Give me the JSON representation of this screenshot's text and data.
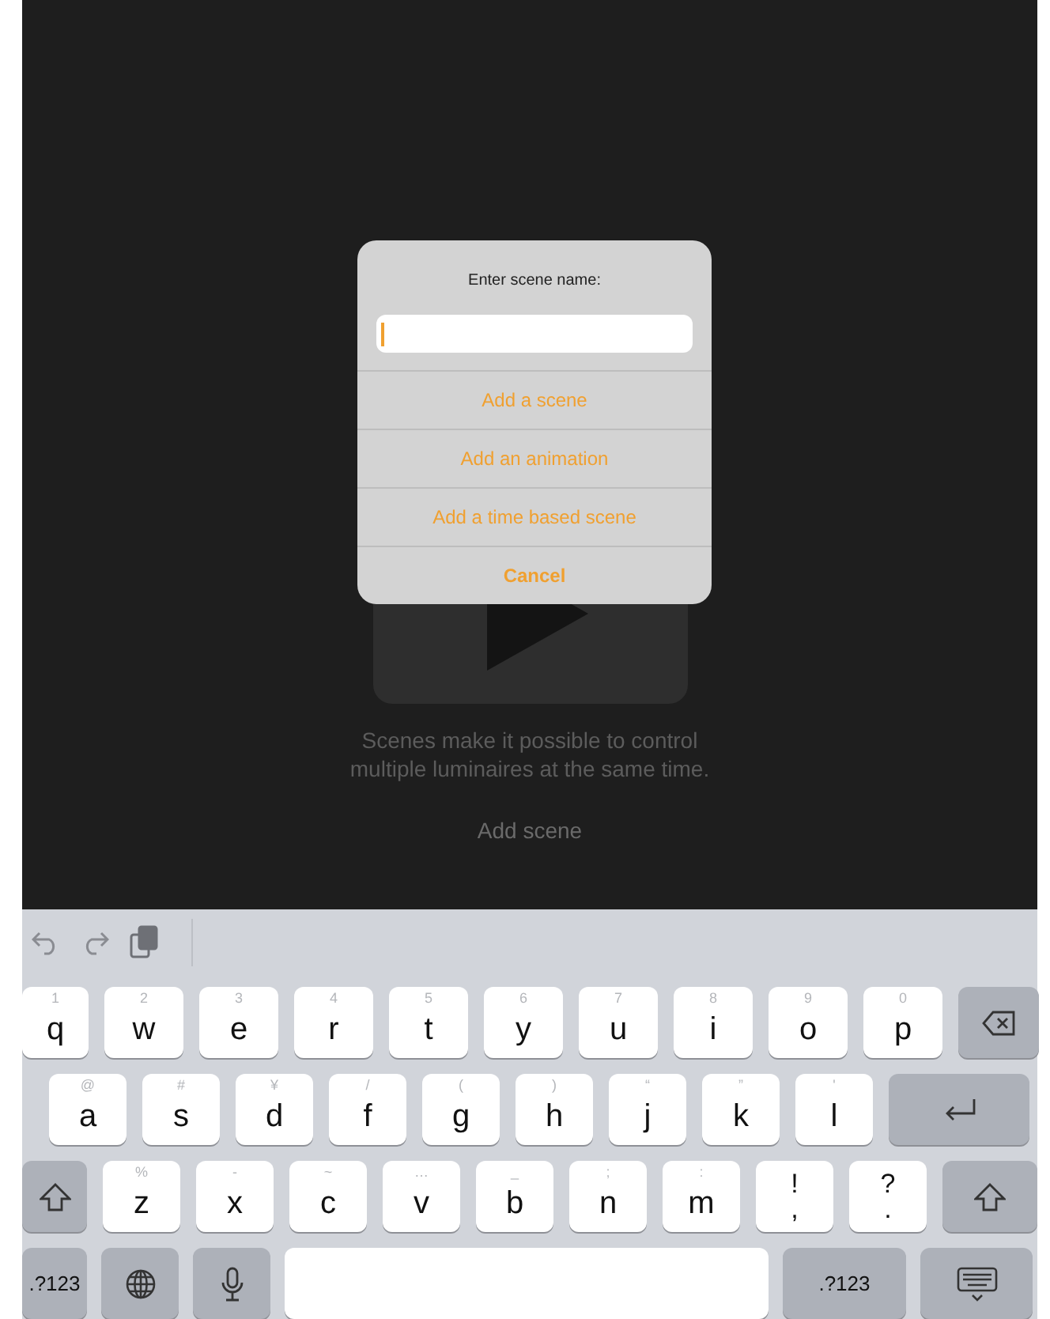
{
  "background": {
    "description": "Scenes make it possible to control multiple luminaires at the same time.",
    "add_button": "Add scene"
  },
  "dialog": {
    "title": "Enter scene name:",
    "input": {
      "focused": true
    },
    "actions": [
      {
        "label": "Add a scene",
        "kind": "action"
      },
      {
        "label": "Add an animation",
        "kind": "action"
      },
      {
        "label": "Add a time based scene",
        "kind": "action"
      },
      {
        "label": "Cancel",
        "kind": "cancel"
      }
    ]
  },
  "keyboard": {
    "rows": [
      [
        {
          "kind": "char",
          "label": "q",
          "hint": "1"
        },
        {
          "kind": "char",
          "label": "w",
          "hint": "2"
        },
        {
          "kind": "char",
          "label": "e",
          "hint": "3"
        },
        {
          "kind": "char",
          "label": "r",
          "hint": "4"
        },
        {
          "kind": "char",
          "label": "t",
          "hint": "5"
        },
        {
          "kind": "char",
          "label": "y",
          "hint": "6"
        },
        {
          "kind": "char",
          "label": "u",
          "hint": "7"
        },
        {
          "kind": "char",
          "label": "i",
          "hint": "8"
        },
        {
          "kind": "char",
          "label": "o",
          "hint": "9"
        },
        {
          "kind": "char",
          "label": "p",
          "hint": "0"
        },
        {
          "kind": "delete"
        }
      ],
      [
        {
          "kind": "char",
          "label": "a",
          "hint": "@"
        },
        {
          "kind": "char",
          "label": "s",
          "hint": "#"
        },
        {
          "kind": "char",
          "label": "d",
          "hint": "¥"
        },
        {
          "kind": "char",
          "label": "f",
          "hint": "/"
        },
        {
          "kind": "char",
          "label": "g",
          "hint": "("
        },
        {
          "kind": "char",
          "label": "h",
          "hint": ")"
        },
        {
          "kind": "char",
          "label": "j",
          "hint": "“"
        },
        {
          "kind": "char",
          "label": "k",
          "hint": "”"
        },
        {
          "kind": "char",
          "label": "l",
          "hint": "'"
        },
        {
          "kind": "return"
        }
      ],
      [
        {
          "kind": "shift"
        },
        {
          "kind": "char",
          "label": "z",
          "hint": "%"
        },
        {
          "kind": "char",
          "label": "x",
          "hint": "-"
        },
        {
          "kind": "char",
          "label": "c",
          "hint": "~"
        },
        {
          "kind": "char",
          "label": "v",
          "hint": "…"
        },
        {
          "kind": "char",
          "label": "b",
          "hint": "_"
        },
        {
          "kind": "char",
          "label": "n",
          "hint": ";"
        },
        {
          "kind": "char",
          "label": "m",
          "hint": ":"
        },
        {
          "kind": "stack",
          "label": ",",
          "hint": "!"
        },
        {
          "kind": "stack",
          "label": ".",
          "hint": "?"
        },
        {
          "kind": "shift"
        }
      ],
      [
        {
          "kind": "mode",
          "label": ".?123"
        },
        {
          "kind": "globe"
        },
        {
          "kind": "mic"
        },
        {
          "kind": "space"
        },
        {
          "kind": "mode",
          "label": ".?123"
        },
        {
          "kind": "hide"
        }
      ]
    ]
  }
}
